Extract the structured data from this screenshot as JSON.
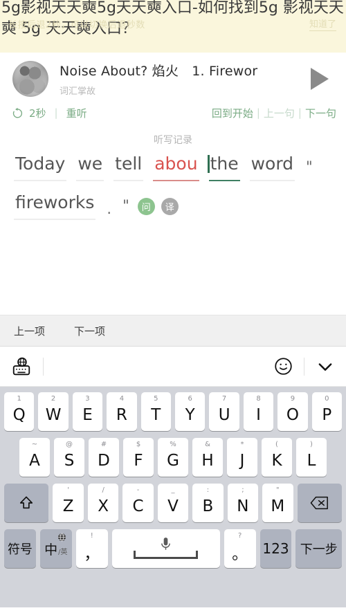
{
  "banner": {
    "title": "5g影视天天奭5g天天奭入口-如何找到5g 影视天天奭 5g 天天奭入口？",
    "ghost_hint": "长按后退2秒，可以切换后退秒数",
    "ghost_ok": "知道了"
  },
  "player": {
    "avatar_name": "podcast-cover",
    "title": "Noise About? 焰火　1. Firewor",
    "subtitle": "词汇掌故",
    "play_icon": "play-triangle-icon"
  },
  "controls": {
    "rewind_icon": "rewind-2s-icon",
    "rewind_label": "2秒",
    "replay_label": "重听",
    "separator": "|",
    "back_to_start": "回到开始",
    "prev_sentence": "上一句",
    "next_sentence": "下一句"
  },
  "dictation": {
    "heading": "听写记录",
    "line1": [
      {
        "text": "Today",
        "state": "normal"
      },
      {
        "text": "we",
        "state": "normal"
      },
      {
        "text": "tell",
        "state": "normal"
      },
      {
        "text": "abou",
        "state": "error"
      },
      {
        "text": "the",
        "state": "cursor"
      },
      {
        "text": "word",
        "state": "normal"
      },
      {
        "text": "\"",
        "state": "punct"
      }
    ],
    "line2": [
      {
        "text": "fireworks",
        "state": "normal"
      },
      {
        "text": ".",
        "state": "dot"
      },
      {
        "text": "\"",
        "state": "punct"
      }
    ],
    "chips": [
      {
        "label": "问",
        "kind": "ask"
      },
      {
        "label": "译",
        "kind": "translate"
      }
    ]
  },
  "bottom_nav": {
    "prev_item": "上一项",
    "next_item": "下一项"
  },
  "keyboard": {
    "toolbar": {
      "globe_keyboard_icon": "globe-keyboard-icon",
      "emoji_icon": "smiley-face-icon",
      "dismiss_icon": "chevron-down-icon"
    },
    "row1": [
      {
        "hint": "1",
        "main": "Q"
      },
      {
        "hint": "2",
        "main": "W"
      },
      {
        "hint": "3",
        "main": "E"
      },
      {
        "hint": "4",
        "main": "R"
      },
      {
        "hint": "5",
        "main": "T"
      },
      {
        "hint": "6",
        "main": "Y"
      },
      {
        "hint": "7",
        "main": "U"
      },
      {
        "hint": "8",
        "main": "I"
      },
      {
        "hint": "9",
        "main": "O"
      },
      {
        "hint": "0",
        "main": "P"
      }
    ],
    "row2": [
      {
        "hint": "~",
        "main": "A"
      },
      {
        "hint": "@",
        "main": "S"
      },
      {
        "hint": "#",
        "main": "D"
      },
      {
        "hint": "$",
        "main": "F"
      },
      {
        "hint": "%",
        "main": "G"
      },
      {
        "hint": "&",
        "main": "H"
      },
      {
        "hint": "*",
        "main": "J"
      },
      {
        "hint": "(",
        "main": "K"
      },
      {
        "hint": ")",
        "main": "L"
      }
    ],
    "row3": [
      {
        "hint": "'",
        "main": "Z"
      },
      {
        "hint": "/",
        "main": "X"
      },
      {
        "hint": "-",
        "main": "C"
      },
      {
        "hint": "_",
        "main": "V"
      },
      {
        "hint": ":",
        "main": "B"
      },
      {
        "hint": ";",
        "main": "N"
      },
      {
        "hint": "\"",
        "main": "M"
      }
    ],
    "shift_icon": "shift-arrow-icon",
    "backspace_icon": "backspace-icon",
    "row4": {
      "symbols": "符号",
      "lang_main": "中",
      "lang_sub": "/英",
      "lang_globe_icon": "globe-icon",
      "comma_hint": "!",
      "comma_main": "，",
      "space_mic_icon": "microphone-icon",
      "period_hint": "?",
      "period_main": "。",
      "numbers": "123",
      "next_step": "下一步"
    }
  },
  "colors": {
    "banner_bg": "#faf6dc",
    "accent_green": "#7aab84",
    "error_red": "#d9534f",
    "cursor_green": "#2f6f52",
    "keyboard_bg": "#d2d4da",
    "fn_key": "#aeb3bf"
  }
}
